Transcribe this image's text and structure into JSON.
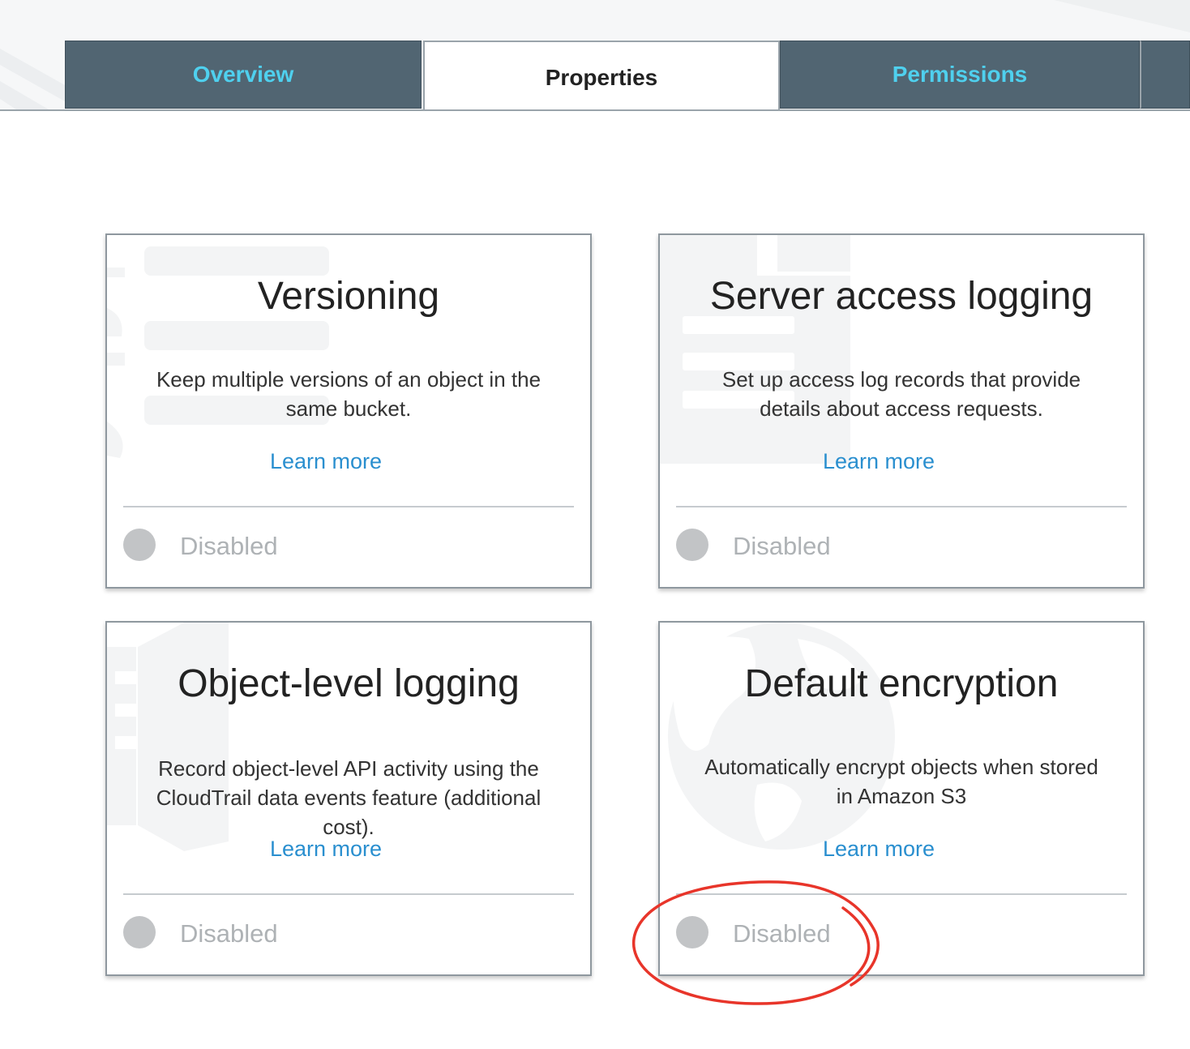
{
  "tabs": [
    {
      "label": "Overview",
      "active": false
    },
    {
      "label": "Properties",
      "active": true
    },
    {
      "label": "Permissions",
      "active": false
    }
  ],
  "cards": [
    {
      "title": "Versioning",
      "description": "Keep multiple versions of an object in the same bucket.",
      "learn_more": "Learn more",
      "status": "Disabled",
      "icon": "stacked-versions-icon"
    },
    {
      "title": "Server access logging",
      "description": "Set up access log records that provide details about access requests.",
      "learn_more": "Learn more",
      "status": "Disabled",
      "icon": "log-document-icon"
    },
    {
      "title": "Object-level logging",
      "description": "Record object-level API activity using the CloudTrail data events feature (additional cost).",
      "learn_more": "Learn more",
      "status": "Disabled",
      "icon": "cloudtrail-icon"
    },
    {
      "title": "Default encryption",
      "description": "Automatically encrypt objects when stored in Amazon S3",
      "learn_more": "Learn more",
      "status": "Disabled",
      "icon": "globe-icon"
    }
  ],
  "colors": {
    "tab_inactive_bg": "#516572",
    "tab_inactive_text": "#4fd0ee",
    "link": "#2a8fcf",
    "status_disabled": "#aeb2b5",
    "annotation": "#e8352a"
  }
}
